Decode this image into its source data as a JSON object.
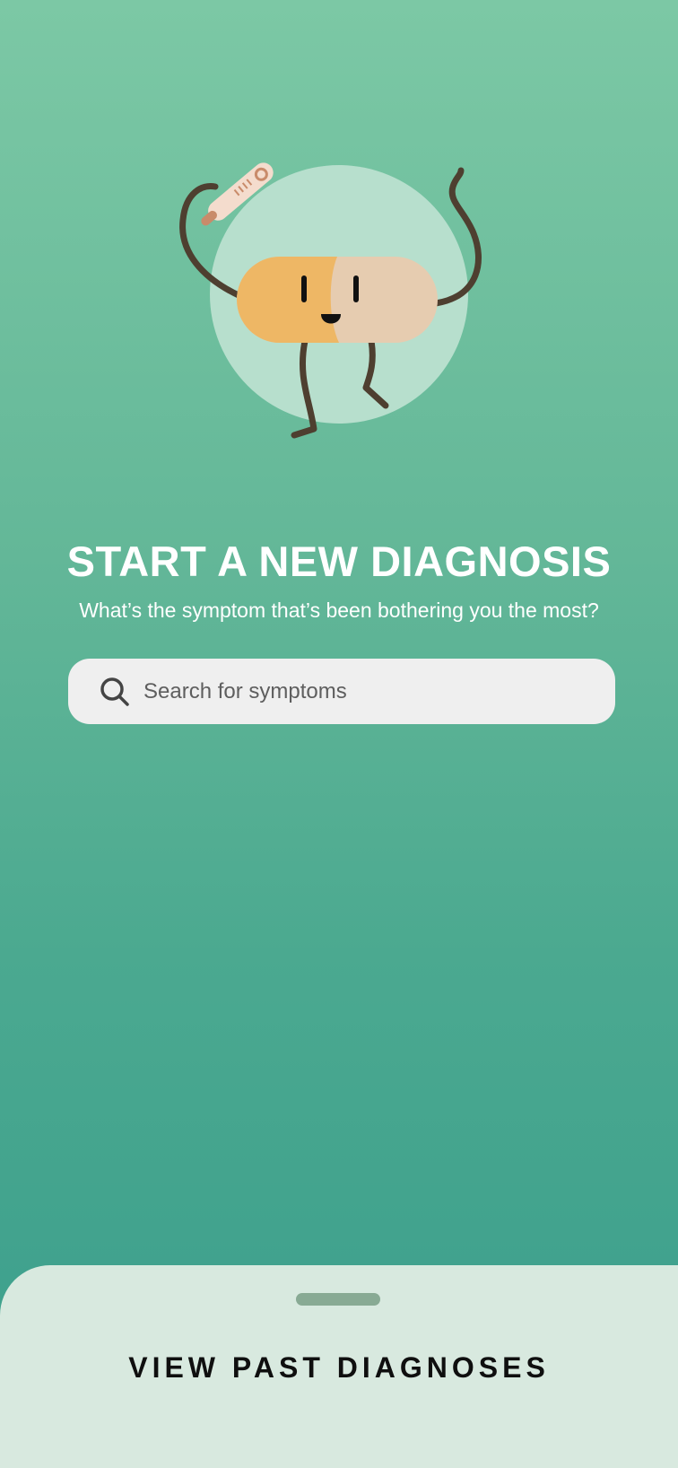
{
  "main": {
    "title": "START A NEW DIAGNOSIS",
    "subtitle": "What’s the symptom that’s been bothering you the most?"
  },
  "search": {
    "placeholder": "Search for symptoms",
    "value": "",
    "icon": "search-icon"
  },
  "bottom_sheet": {
    "title": "VIEW PAST DIAGNOSES",
    "handle_icon": "drag-handle"
  },
  "illustration": {
    "icon": "pill-mascot-with-thermometer-icon"
  },
  "colors": {
    "background_top": "#7cc8a5",
    "background_bottom": "#3a9e8c",
    "search_background": "#efefef",
    "sheet_background": "#d8e9df",
    "sheet_handle": "#88aa94",
    "pill_left": "#eeb765",
    "pill_right": "#e6ccb0",
    "limbs": "#4e3f30"
  }
}
